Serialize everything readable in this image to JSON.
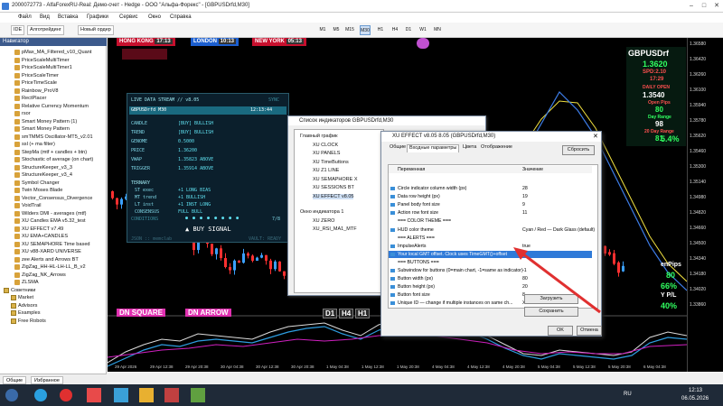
{
  "window": {
    "title": "2000072773 - AlfaForexRU-Real: Демо-счет - Hedge - ООО \"Альфа-Форекс\" - [GBPUSDrfd,M30]"
  },
  "menu": [
    "Файл",
    "Вид",
    "Вставка",
    "Графики",
    "Сервис",
    "Окно",
    "Справка"
  ],
  "toolbar": {
    "ide": "IDE",
    "algo": "Алготрейдинг",
    "new_order": "Новый ордер",
    "timeframes": [
      "M1",
      "M5",
      "M15",
      "M30",
      "H1",
      "H4",
      "D1",
      "W1",
      "MN"
    ],
    "selected_tf": "M30"
  },
  "navigator": {
    "title": "Навигатор",
    "items": [
      "pMax_MA_Filtered_v10_Quant",
      "PriceScaleMultiTimer",
      "PriceScaleMultiTimer1",
      "PriceScaleTimer",
      "PriceTimeScale",
      "Rainbow_ProV8",
      "RectPlacer",
      "Relative Currency Momentum",
      "rsor",
      "Smart Money Pattern (1)",
      "Smart Money Pattern",
      "smTMMS Oscillator-MT5_v2.01",
      "ssl (+ ma filter)",
      "StepMa (mtf + candles + btn)",
      "Stochastic of average (on chart)",
      "StructureKeeper_v3_3",
      "StructureKeeper_v3_4",
      "Symbol Changer",
      "Twin Moses Blade",
      "Vector_Consensus_Divergence",
      "VoidTrail",
      "Wilders DMI - averages (mtf)",
      "XU Candles EMA v5.32_test",
      "XU EFFECT v7.49",
      "XU EMA+CANDLES",
      "XU SEMAPHORE Time based",
      "XU v88-XARD UNIVERSE",
      "zee Alerts and Arrows BT",
      "ZigZag_HH-HL-LH-LL_B_v2",
      "ZigZag_NK_Arrows",
      "ZLSMA"
    ],
    "groups": [
      "Советники",
      "Market",
      "Advisors",
      "Examples",
      "Free Robots"
    ],
    "tabs": [
      "Общие",
      "Избранное"
    ]
  },
  "sessions": [
    {
      "name": "HONG KONG",
      "time": "17:13",
      "color": "#c8102e"
    },
    {
      "name": "LONDON",
      "time": "10:13",
      "color": "#1c5fd0"
    },
    {
      "name": "NEW YORK",
      "time": "05:13",
      "color": "#c8102e"
    }
  ],
  "chart_labels": {
    "dn_square": "DN SQUARE",
    "dn_arrow": "DN ARROW",
    "d1": "D1",
    "h4": "H4",
    "h1": "H1"
  },
  "right_panel": {
    "symbol": "GBPUSDrf",
    "price": "1.3620",
    "spd": "SPD:2.10",
    "time": "17:29",
    "daily_open": "DAILY OPEN",
    "open_price": "1.3540",
    "open_pips": "Open Pips",
    "pips_val": "80",
    "day_range": "Day Range",
    "range_val": "98",
    "range20": "20 Day Range",
    "r20_val": "81",
    "pct": "5.4%",
    "pips_lbl": "enPips",
    "pips_num": "80",
    "pct2": "66%",
    "pl": "Y P/L",
    "pct3": "40%"
  },
  "price_scale": [
    "1.36580",
    "1.36420",
    "1.36260",
    "1.36100",
    "1.35940",
    "1.35780",
    "1.35620",
    "1.35460",
    "1.35300",
    "1.35140",
    "1.34980",
    "1.34820",
    "1.34660",
    "1.34500",
    "1.34340",
    "1.34180",
    "1.34020",
    "1.33860"
  ],
  "time_axis": [
    "29 Apr 2026",
    "29 Apr 12:38",
    "29 Apr 20:38",
    "30 Apr 04:38",
    "30 Apr 12:38",
    "30 Apr 20:38",
    "1 May 04:38",
    "1 May 12:38",
    "1 May 20:38",
    "4 May 04:38",
    "4 May 12:38",
    "4 May 20:38",
    "5 May 04:38",
    "5 May 12:38",
    "5 May 20:38",
    "6 May 04:38"
  ],
  "live_stream": {
    "header": "LIVE DATA STREAM // v8.05",
    "sync": "SYNC",
    "pair": "GBPUSDrfd  M30",
    "clock": "12:13:44",
    "rows": [
      [
        "CANDLE",
        "[BUY] BULLISH"
      ],
      [
        "TREND",
        "[BUY] BULLISH"
      ],
      [
        "GENOME",
        "0.5000"
      ],
      [
        "PRICE",
        "1.36200"
      ],
      [
        "VWAP",
        "1.35823  ABOVE"
      ],
      [
        "TRIGGER",
        "1.35914  ABOVE"
      ]
    ],
    "ternary": "TERNARY",
    "t_rows": [
      [
        "ST  exec",
        "+1  LONG BIAS"
      ],
      [
        "MT  trend",
        "+1  BULLISH"
      ],
      [
        "LT  inst",
        "+1  INST LONG"
      ],
      [
        "CONSENSUS",
        "FULL BULL"
      ]
    ],
    "conditions": "CONDITIONS",
    "cond_count": "7/8",
    "signal": "BUY SIGNAL",
    "footer_l": "JSON :: memclab",
    "footer_r": "VAULT: READY"
  },
  "dlg_indicators": {
    "title": "Список индикаторов GBPUSDrfd,M30",
    "tree": [
      "Главный график",
      "XU CLOCK",
      "XU PANELS",
      "XU TimeButtons",
      "XU Z1 LINE",
      "XU SEMAPHORE X",
      "XU SESSIONS BT",
      "XU EFFECT v8.05",
      "Окно индикатора 1",
      "XU ZERO",
      "XU_RSI_MA1_MTF"
    ]
  },
  "dlg_props": {
    "title": "XU EFFECT v8.05 8.05 (GBPUSDrfd,M30)",
    "tabs": [
      "Общие",
      "Входные параметры",
      "Цвета",
      "Отображение"
    ],
    "col_var": "Переменная",
    "col_val": "Значение",
    "rows": [
      [
        "Circle indicator column width (px)",
        "28"
      ],
      [
        "Data row height (px)",
        "19"
      ],
      [
        "Panel body font size",
        "9"
      ],
      [
        "Action row font size",
        "11"
      ],
      [
        "=== COLOR THEME ===",
        ""
      ],
      [
        "HUD color theme",
        "Cyan / Red   — Dark Glass (default)"
      ],
      [
        "=== ALERTS ===",
        ""
      ],
      [
        "ImpulseAlerts",
        "true"
      ],
      [
        "Your local GMT offset. Clock uses TimeGMT()+offset",
        "3"
      ],
      [
        "=== BUTTONS ===",
        ""
      ],
      [
        "Subwindow for buttons (0=main chart, -1=same as indicator)",
        "-1"
      ],
      [
        "Button width (px)",
        "80"
      ],
      [
        "Button height (px)",
        "20"
      ],
      [
        "Button font size",
        "8"
      ],
      [
        "Unique ID — change if multiple instances on same ch...",
        "XU800"
      ]
    ],
    "btn_load": "Загрузить",
    "btn_save": "Сохранить",
    "btn_ok": "OK",
    "btn_cancel": "Отмена",
    "btn_reset": "Сбросить"
  },
  "taskbar": {
    "lang": "RU",
    "time": "12:13",
    "date": "06.05.2026"
  }
}
